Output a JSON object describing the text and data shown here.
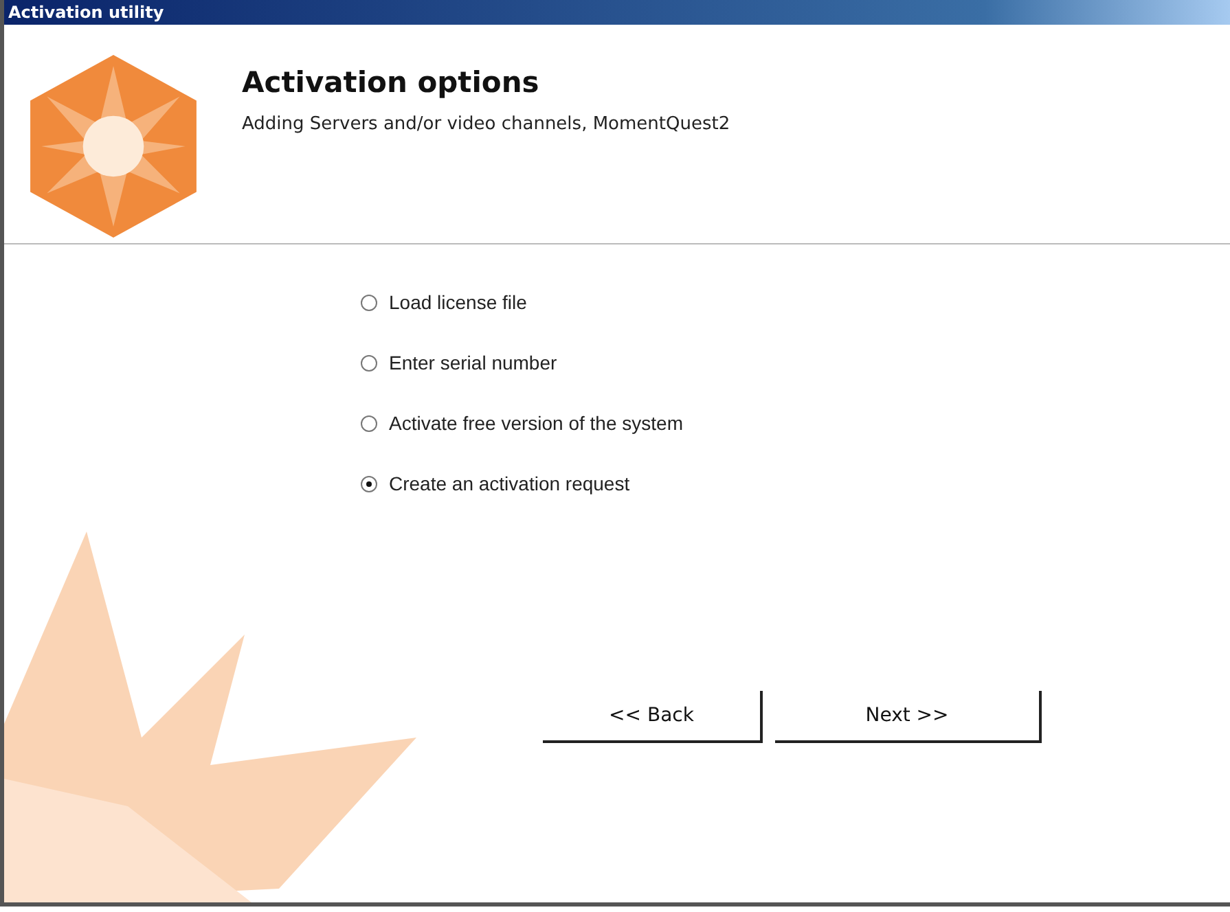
{
  "window": {
    "title": "Activation utility"
  },
  "header": {
    "title": "Activation options",
    "subtitle": "Adding Servers and/or video channels, MomentQuest2"
  },
  "options": [
    {
      "label": "Load license file",
      "selected": false
    },
    {
      "label": "Enter serial number",
      "selected": false
    },
    {
      "label": "Activate free version of the system",
      "selected": false
    },
    {
      "label": "Create an activation request",
      "selected": true
    }
  ],
  "buttons": [
    {
      "label": "<< Back"
    },
    {
      "label": "Next >>"
    }
  ]
}
